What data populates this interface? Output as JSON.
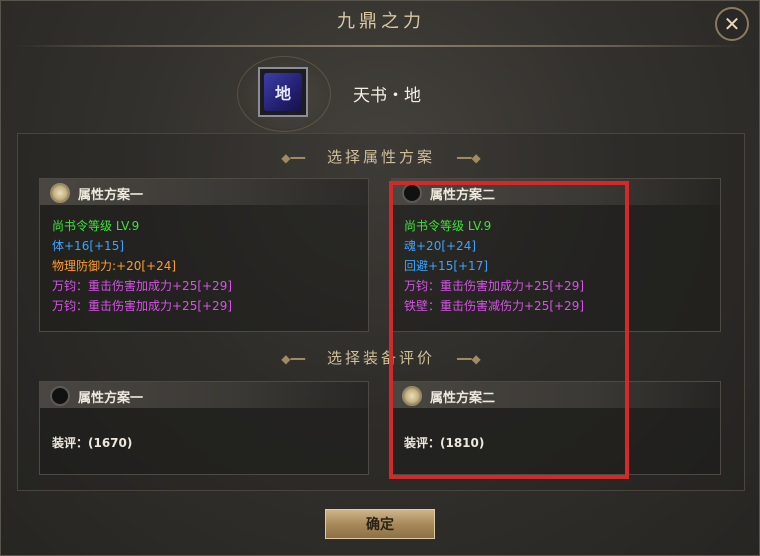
{
  "dialog": {
    "title": "九鼎之力",
    "close_icon": "close-icon"
  },
  "item": {
    "name": "天书・地",
    "icon_glyph": "地"
  },
  "section_attr": {
    "title": "选择属性方案",
    "options": [
      {
        "label": "属性方案一",
        "selected": true,
        "lines": [
          {
            "text": "尚书令等级 LV.9",
            "color": "#3fe23c"
          },
          {
            "text": "体+16[+15]",
            "color": "#3da3ff"
          },
          {
            "text": "物理防御力:+20[+24]",
            "color": "#ff9c2a"
          },
          {
            "text": "万钧：重击伤害加成力+25[+29]",
            "color": "#d653e6"
          },
          {
            "text": "万钧：重击伤害加成力+25[+29]",
            "color": "#d653e6"
          }
        ]
      },
      {
        "label": "属性方案二",
        "selected": false,
        "lines": [
          {
            "text": "尚书令等级 LV.9",
            "color": "#3fe23c"
          },
          {
            "text": "魂+20[+24]",
            "color": "#3da3ff"
          },
          {
            "text": "回避+15[+17]",
            "color": "#3da3ff"
          },
          {
            "text": "万钧：重击伤害加成力+25[+29]",
            "color": "#d653e6"
          },
          {
            "text": "铁壁：重击伤害减伤力+25[+29]",
            "color": "#d653e6"
          }
        ]
      }
    ]
  },
  "section_equip": {
    "title": "选择装备评价",
    "options": [
      {
        "label": "属性方案一",
        "selected": false,
        "score": "装评：(1670)"
      },
      {
        "label": "属性方案二",
        "selected": true,
        "score": "装评：(1810)"
      }
    ]
  },
  "confirm_label": "确定",
  "colors": {
    "highlight_border": "#d22a2a",
    "accent_gold": "#cdb58a"
  }
}
